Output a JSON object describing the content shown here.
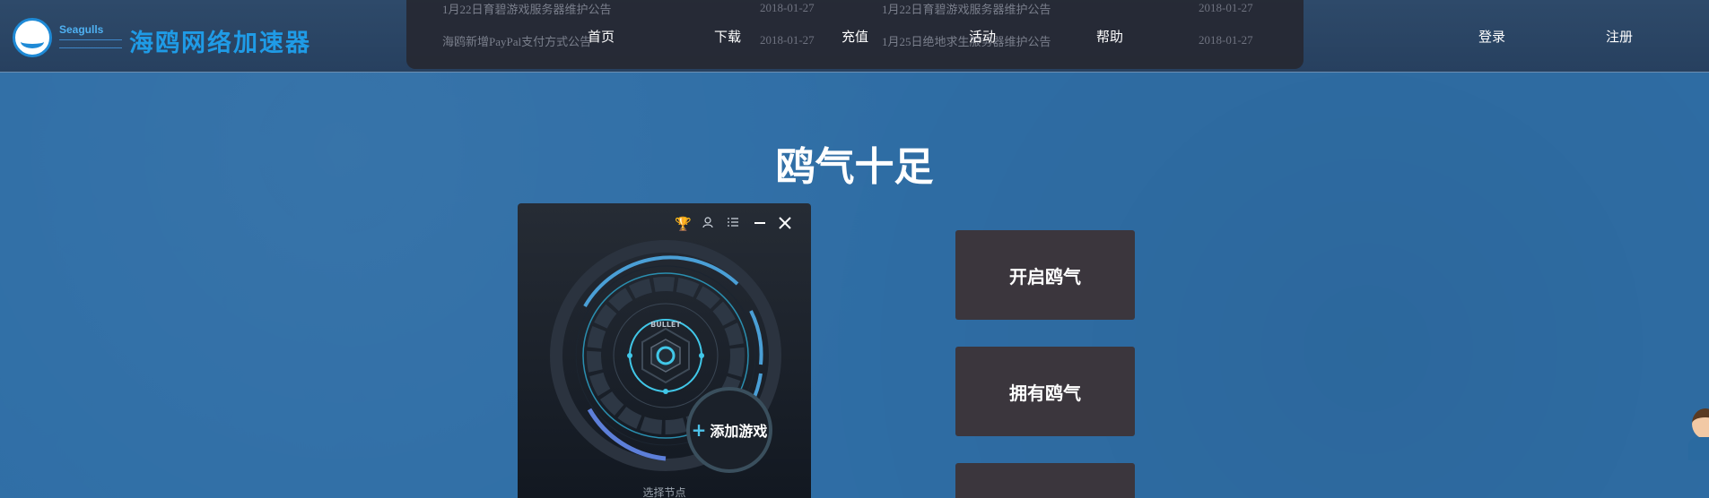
{
  "logo": {
    "en": "Seagulls"
  },
  "brand": "海鸥网络加速器",
  "notices": [
    {
      "title": "1月22日育碧游戏服务器维护公告",
      "date": "2018-01-27"
    },
    {
      "title": "海鸥新增PayPal支付方式公告",
      "date": "2018-01-27"
    },
    {
      "title": "1月22日育碧游戏服务器维护公告",
      "date": "2018-01-27"
    },
    {
      "title": "1月25日绝地求生服务器维护公告",
      "date": "2018-01-27"
    }
  ],
  "nav": {
    "home": "首页",
    "download": "下载",
    "recharge": "充值",
    "activity": "活动",
    "help": "帮助",
    "login": "登录",
    "register": "注册"
  },
  "hero": {
    "title": "鸥气十足"
  },
  "app": {
    "add_game": "添加游戏",
    "node_label": "选择节点",
    "dial_text": "BULLET",
    "icons": [
      "trophy-icon",
      "user-icon",
      "list-icon",
      "minimize-icon",
      "close-icon"
    ]
  },
  "features": [
    "开启鸥气",
    "拥有鸥气",
    ""
  ],
  "colors": {
    "background": "#2f6ea6",
    "header": "#2b4565",
    "brand": "#1f9be6",
    "button": "#3b363d",
    "accent": "#4ec3ea"
  }
}
